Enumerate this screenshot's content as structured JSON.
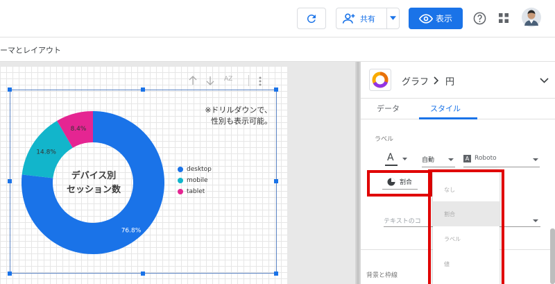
{
  "topbar": {
    "share_label": "共有",
    "view_label": "表示",
    "colors": {
      "view_button_bg": "#1a73e8",
      "share_icon": "#1a73e8"
    },
    "icons": [
      "refresh-icon",
      "add-person-icon",
      "caret-down-icon",
      "eye-icon",
      "help-icon",
      "apps-grid-icon",
      "avatar"
    ]
  },
  "subbar": {
    "breadcrumb_text": "ーマとレイアウト"
  },
  "chart": {
    "center_title_line1": "デバイス別",
    "center_title_line2": "セッション数",
    "note_line1": "※ドリルダウンで、",
    "note_line2": "性別も表示可能。",
    "toolbar_sort_label": "AZ"
  },
  "chart_data": {
    "type": "pie",
    "donut": true,
    "title": "デバイス別セッション数",
    "categories": [
      "desktop",
      "mobile",
      "tablet"
    ],
    "values": [
      76.8,
      14.8,
      8.4
    ],
    "value_labels": [
      "76.8%",
      "14.8%",
      "8.4%"
    ],
    "colors": [
      "#1a73e8",
      "#12b5cb",
      "#e52592"
    ],
    "legend_position": "right"
  },
  "panel": {
    "chart_type_label": "グラフ",
    "chart_subtype_label": "円",
    "tabs": [
      {
        "label": "データ"
      },
      {
        "label": "スタイル",
        "active": true
      }
    ],
    "section_label": "ラベル",
    "font_color_letter": "A",
    "font_size_value": "自動",
    "font_family_value": "Roboto",
    "label_type_value": "割合",
    "text_placeholder": "テキストのコ",
    "section_bg_label": "背景と枠線",
    "dropdown_options": [
      "なし",
      "割合",
      "ラベル",
      "値"
    ],
    "highlight_color": "#e00000"
  }
}
